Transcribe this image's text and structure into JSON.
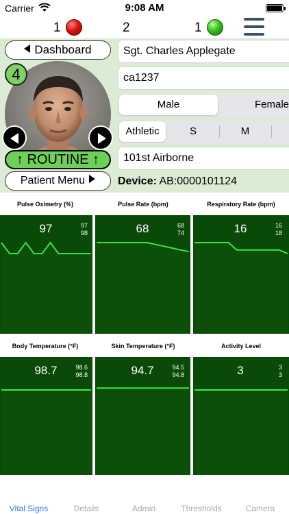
{
  "status_bar": {
    "carrier": "Carrier",
    "time": "9:08 AM"
  },
  "counts": {
    "red_count": "1",
    "middle_count": "2",
    "green_count": "1"
  },
  "panel": {
    "dashboard_label": "Dashboard",
    "priority_number": "4",
    "triage_label": "↑ ROUTINE ↑",
    "patient_menu_label": "Patient Menu",
    "name": "Sgt. Charles Applegate",
    "user_id": "ca1237",
    "sex_options": [
      "Male",
      "Female"
    ],
    "sex_selected": "Male",
    "build_options": [
      "Athletic",
      "S",
      "M"
    ],
    "build_selected": "Athletic",
    "unit": "101st Airborne",
    "device_label": "Device:",
    "device_id": "AB:0000101124"
  },
  "vitals": [
    {
      "label": "Pulse Oximetry (%)",
      "value": "97",
      "range_top": "97",
      "range_bottom": "98",
      "trace": [
        98,
        97,
        97,
        98,
        97,
        97,
        98,
        97,
        97,
        97,
        97,
        97
      ]
    },
    {
      "label": "Pulse Rate (bpm)",
      "value": "68",
      "range_top": "68",
      "range_bottom": "74",
      "trace": [
        74,
        74,
        74,
        74,
        74,
        74,
        74,
        73,
        72,
        71,
        70,
        69
      ]
    },
    {
      "label": "Respiratory Rate (bpm)",
      "value": "16",
      "range_top": "16",
      "range_bottom": "18",
      "trace": [
        18,
        18,
        18,
        18,
        18,
        16,
        16,
        16,
        16,
        16,
        16,
        15
      ]
    },
    {
      "label": "Body Temperature (°F)",
      "value": "98.7",
      "range_top": "98.6",
      "range_bottom": "98.8",
      "trace": [
        98.7,
        98.7,
        98.7,
        98.7,
        98.7,
        98.7,
        98.7,
        98.7,
        98.7,
        98.7,
        98.7,
        98.7
      ]
    },
    {
      "label": "Skin Temperature (°F)",
      "value": "94.7",
      "range_top": "94.5",
      "range_bottom": "94.8",
      "trace": [
        94.7,
        94.7,
        94.7,
        94.7,
        94.7,
        94.7,
        94.7,
        94.7,
        94.7,
        94.7,
        94.7,
        94.7
      ]
    },
    {
      "label": "Activity Level",
      "value": "3",
      "range_top": "3",
      "range_bottom": "3",
      "trace": [
        3,
        3,
        3,
        3,
        3,
        3,
        3,
        3,
        3,
        3,
        3,
        3
      ]
    }
  ],
  "tabs": [
    {
      "label": "Vital Signs",
      "active": true
    },
    {
      "label": "Details",
      "active": false
    },
    {
      "label": "Admin",
      "active": false
    },
    {
      "label": "Thresholds",
      "active": false
    },
    {
      "label": "Camera",
      "active": false
    }
  ],
  "colors": {
    "tile_background": "#0a4a08",
    "trace_line": "#3ee24a",
    "active_tab": "#2a7cf6",
    "panel_background": "#dcebd4"
  },
  "icons": {
    "wifi": "wifi-icon",
    "battery": "battery-icon",
    "menu": "hamburger-menu-icon",
    "red_status": "red-status-dot-icon",
    "green_status": "green-status-dot-icon"
  }
}
